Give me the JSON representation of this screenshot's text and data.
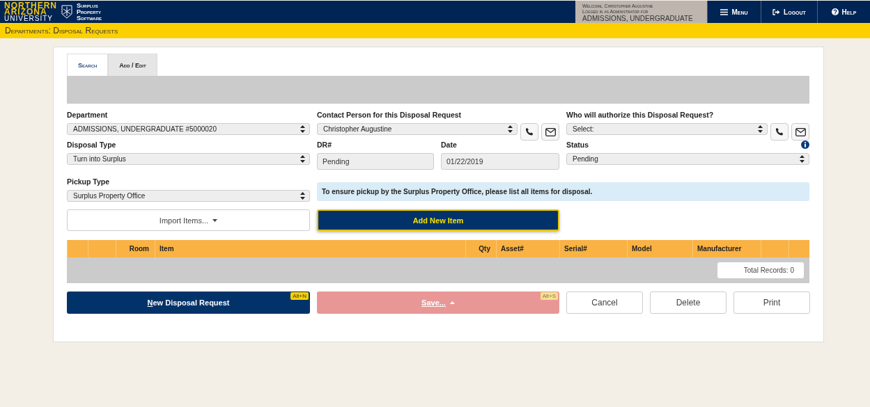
{
  "header": {
    "logo_lines": [
      "NORTHERN",
      "ARIZONA",
      "UNIVERSITY"
    ],
    "app_name_lines": [
      "Surplus",
      "Property",
      "Software"
    ],
    "welcome_lines": [
      "Welcome, Christopher Augustine",
      "Logged in as Administrator for",
      "ADMISSIONS, UNDERGRADUATE"
    ],
    "nav": [
      {
        "label": "Menu",
        "kind": "menu"
      },
      {
        "label": "Logout",
        "kind": "logout"
      },
      {
        "label": "Help",
        "kind": "help"
      }
    ]
  },
  "page_title": "Departments: Disposal Requests",
  "tabs": [
    {
      "label": "Search",
      "selected": false
    },
    {
      "label": "Add / Edit",
      "selected": true
    }
  ],
  "form": {
    "department": {
      "label": "Department",
      "value": "ADMISSIONS, UNDERGRADUATE #5000020"
    },
    "contact": {
      "label": "Contact Person for this Disposal Request",
      "value": "Christopher Augustine"
    },
    "authorizer": {
      "label": "Who will authorize this Disposal Request?",
      "value": "Select:"
    },
    "disposal_type": {
      "label": "Disposal Type",
      "value": "Turn into Surplus"
    },
    "dr_number": {
      "label": "DR#",
      "value": "Pending",
      "disabled": true
    },
    "date": {
      "label": "Date",
      "value": "01/22/2019",
      "disabled": true
    },
    "status": {
      "label": "Status",
      "value": "Pending"
    },
    "pickup_type": {
      "label": "Pickup Type",
      "value": "Surplus Property Office"
    },
    "notice": "To ensure pickup by the Surplus Property Office, please list all items for disposal.",
    "import_button": "Import Items...",
    "add_button": "Add New Item"
  },
  "table": {
    "columns": [
      "",
      "",
      "Room",
      "Item",
      "Qty",
      "Asset#",
      "Serial#",
      "Model",
      "Manufacturer",
      "",
      ""
    ],
    "total_records": "Total Records: 0"
  },
  "actions": [
    {
      "label": "New Disposal Request",
      "kind": "primary",
      "shortcut": "Alt+N"
    },
    {
      "label": "Save...",
      "kind": "danger",
      "shortcut": "Alt+S"
    },
    {
      "label": "Cancel",
      "kind": "default"
    },
    {
      "label": "Delete",
      "kind": "default"
    },
    {
      "label": "Print",
      "kind": "default"
    }
  ]
}
